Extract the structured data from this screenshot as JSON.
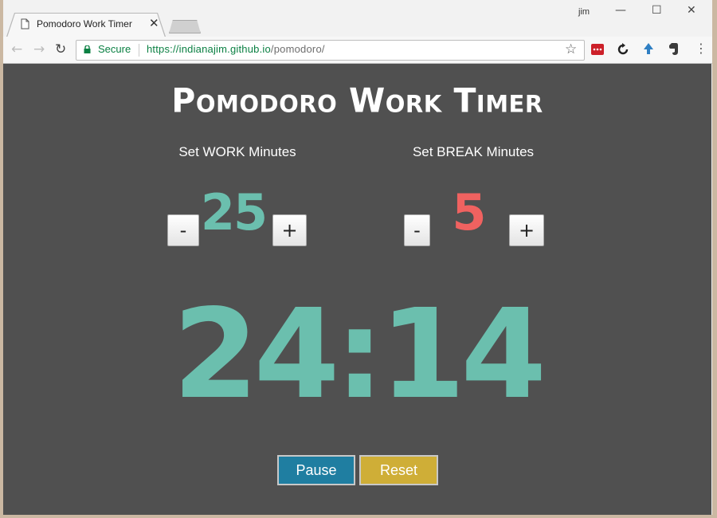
{
  "browser": {
    "tab_title": "Pomodoro Work Timer",
    "tab_close": "✕",
    "profile_name": "jim",
    "window_controls": {
      "minimize": "—",
      "maximize": "☐",
      "close": "✕"
    },
    "nav": {
      "back": "←",
      "forward": "→",
      "reload": "↻"
    },
    "secure_label": "Secure",
    "url_host": "https://indianajim.github.io",
    "url_path": "/pomodoro/",
    "bookmark_icon": "☆",
    "menu_icon": "⋮",
    "extensions": [
      "lastpass-icon",
      "sync-icon",
      "download-icon",
      "evernote-icon"
    ]
  },
  "app": {
    "title": "Pomodoro Work Timer",
    "work": {
      "label": "Set WORK Minutes",
      "minutes": "25",
      "decrement": "-",
      "increment": "+"
    },
    "break": {
      "label": "Set BREAK Minutes",
      "minutes": "5",
      "decrement": "-",
      "increment": "+"
    },
    "timer": "24:14",
    "pause_label": "Pause",
    "reset_label": "Reset"
  },
  "colors": {
    "background": "#505050",
    "work_accent": "#6bbfae",
    "break_accent": "#f06260",
    "pause_button": "#1f7ea1",
    "reset_button": "#cfae37"
  }
}
